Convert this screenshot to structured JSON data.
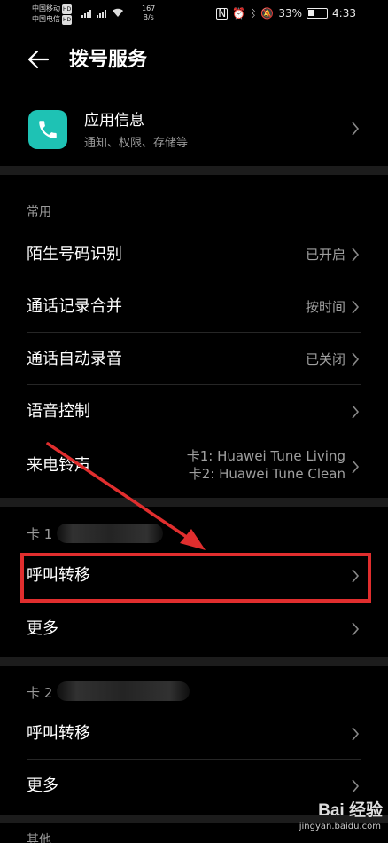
{
  "status_bar": {
    "carrier_1": "中国移动",
    "carrier_2": "中国电信",
    "hd_tag": "HD",
    "net_speed_value": "167",
    "net_speed_unit": "B/s",
    "battery_percent": "33%",
    "time": "4:33"
  },
  "header": {
    "title": "拨号服务"
  },
  "app_info": {
    "name": "应用信息",
    "subtitle": "通知、权限、存储等",
    "icon_color": "#1ec2b4"
  },
  "sections": {
    "common": "常用",
    "card1": "卡 1",
    "card2": "卡 2",
    "other": "其他"
  },
  "rows": {
    "unknown_number": {
      "label": "陌生号码识别",
      "value": "已开启"
    },
    "merge_call_log": {
      "label": "通话记录合并",
      "value": "按时间"
    },
    "auto_record": {
      "label": "通话自动录音",
      "value": "已关闭"
    },
    "voice_control": {
      "label": "语音控制"
    },
    "ringtone": {
      "label": "来电铃声",
      "value_line1": "卡1: Huawei Tune Living",
      "value_line2": "卡2: Huawei Tune Clean"
    },
    "card1_forwarding": {
      "label": "呼叫转移"
    },
    "card1_more": {
      "label": "更多"
    },
    "card2_forwarding": {
      "label": "呼叫转移"
    },
    "card2_more": {
      "label": "更多"
    }
  },
  "annotation": {
    "color": "#e02e2e"
  },
  "watermark": {
    "brand": "Bai 经验",
    "url": "jingyan.baidu.com"
  }
}
